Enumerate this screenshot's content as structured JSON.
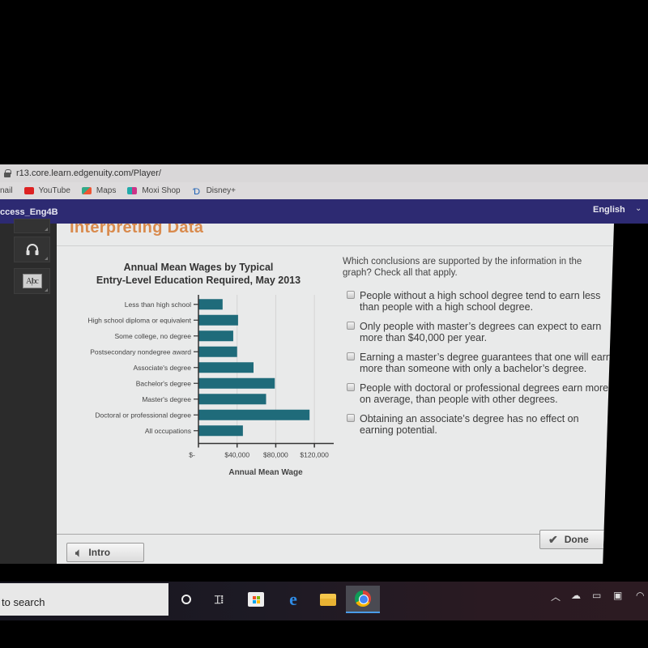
{
  "browser": {
    "url": "r13.core.learn.edgenuity.com/Player/",
    "bookmarks": [
      {
        "label": "nail",
        "icon": "mail-icon"
      },
      {
        "label": "YouTube",
        "icon": "youtube-icon"
      },
      {
        "label": "Maps",
        "icon": "maps-icon"
      },
      {
        "label": "Moxi Shop",
        "icon": "moxi-shop-icon"
      },
      {
        "label": "Disney+",
        "icon": "disney-plus-icon"
      }
    ]
  },
  "topbar": {
    "course": "ccess_Eng4B",
    "language": "English",
    "language_chevron": "⌄"
  },
  "sidebar": {
    "tools": [
      {
        "name": "pencil-icon"
      },
      {
        "name": "headphones-icon",
        "glyph": "🎧"
      },
      {
        "name": "dictionary-icon",
        "glyph": "A|bc"
      }
    ]
  },
  "lesson": {
    "title": "Interpreting Data"
  },
  "question": {
    "prompt": "Which conclusions are supported by the information in the graph? Check all that apply.",
    "options": [
      {
        "text": "People without a high school degree tend to earn less than people with a high school degree.",
        "checked": false
      },
      {
        "text": "Only people with master’s degrees can expect to earn more than $40,000 per year.",
        "checked": false
      },
      {
        "text": "Earning a master’s degree guarantees that one will earn more than someone with only a bachelor’s degree.",
        "checked": false
      },
      {
        "text": "People with doctoral or professional degrees earn more, on average, than people with other degrees.",
        "checked": false
      },
      {
        "text": "Obtaining an associate’s degree has no effect on earning potential.",
        "checked": false
      }
    ]
  },
  "buttons": {
    "intro": "Intro",
    "done": "Done"
  },
  "taskbar": {
    "search_text": "to search",
    "apps": [
      "cortana",
      "task-view",
      "microsoft-store",
      "edge",
      "file-explorer",
      "chrome"
    ],
    "tray": [
      "show-hidden-icons",
      "onedrive",
      "battery",
      "notification",
      "wifi"
    ]
  },
  "chart_data": {
    "type": "bar",
    "orientation": "horizontal",
    "title": "Annual Mean Wages by Typical Entry-Level Education Required, May 2013",
    "title_lines": [
      "Annual Mean Wages by Typical",
      "Entry-Level Education Required, May 2013"
    ],
    "xlabel": "Annual Mean Wage",
    "ylabel": "",
    "categories": [
      "Less than high school",
      "High school diploma or equivalent",
      "Some college, no degree",
      "Postsecondary nondegree award",
      "Associate's degree",
      "Bachelor's degree",
      "Master's degree",
      "Doctoral or professional degree",
      "All occupations"
    ],
    "values": [
      25000,
      41000,
      36000,
      40000,
      57000,
      79000,
      70000,
      115000,
      46000
    ],
    "xlim": [
      0,
      140000
    ],
    "xticks": [
      0,
      40000,
      80000,
      120000
    ],
    "xtick_labels": [
      "$-",
      "$40,000",
      "$80,000",
      "$120,000"
    ],
    "grid": true,
    "bar_color": "#1f6b7a",
    "legend": "none"
  }
}
